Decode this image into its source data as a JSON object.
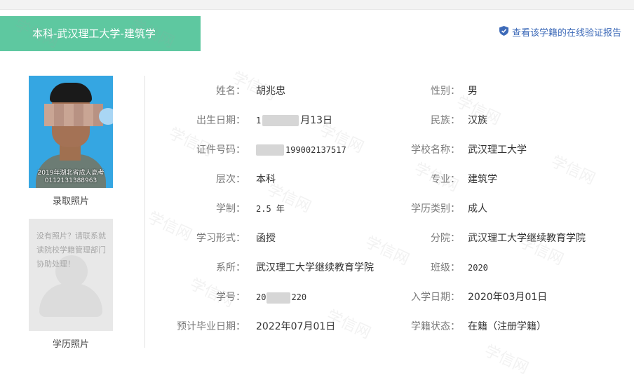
{
  "header": {
    "tab_title": "本科-武汉理工大学-建筑学",
    "verify_link": "查看该学籍的在线验证报告",
    "verify_icon": "shield-check-icon",
    "accent_color": "#5ec8a0",
    "link_color": "#3d6ab8"
  },
  "photos": {
    "admission_caption": "录取照片",
    "admission_overlay_line1": "2019年湖北省成人高考",
    "admission_overlay_line2": "0112131388963",
    "education_caption": "学历照片",
    "education_placeholder": "没有照片？请联系就读院校学籍管理部门协助处理！"
  },
  "fields": {
    "name": {
      "label": "姓名：",
      "value": "胡兆忠"
    },
    "gender": {
      "label": "性别：",
      "value": "男"
    },
    "birth": {
      "label": "出生日期：",
      "value_prefix": "1",
      "value_suffix": "月13日"
    },
    "ethnicity": {
      "label": "民族：",
      "value": "汉族"
    },
    "id_no": {
      "label": "证件号码：",
      "value_suffix": "199002137517"
    },
    "school": {
      "label": "学校名称：",
      "value": "武汉理工大学"
    },
    "level": {
      "label": "层次：",
      "value": "本科"
    },
    "major": {
      "label": "专业：",
      "value": "建筑学"
    },
    "duration": {
      "label": "学制：",
      "value": "2.5 年"
    },
    "edu_type": {
      "label": "学历类别：",
      "value": "成人"
    },
    "study_form": {
      "label": "学习形式：",
      "value": "函授"
    },
    "branch": {
      "label": "分院：",
      "value": "武汉理工大学继续教育学院"
    },
    "department": {
      "label": "系所：",
      "value": "武汉理工大学继续教育学院"
    },
    "class": {
      "label": "班级：",
      "value": "2020"
    },
    "student_no": {
      "label": "学号：",
      "value_prefix": "20",
      "value_suffix": "220"
    },
    "enroll_date": {
      "label": "入学日期：",
      "value": "2020年03月01日"
    },
    "grad_date": {
      "label": "预计毕业日期：",
      "value": "2022年07月01日"
    },
    "status": {
      "label": "学籍状态：",
      "value": "在籍（注册学籍）"
    }
  },
  "watermark_text": "学信网"
}
